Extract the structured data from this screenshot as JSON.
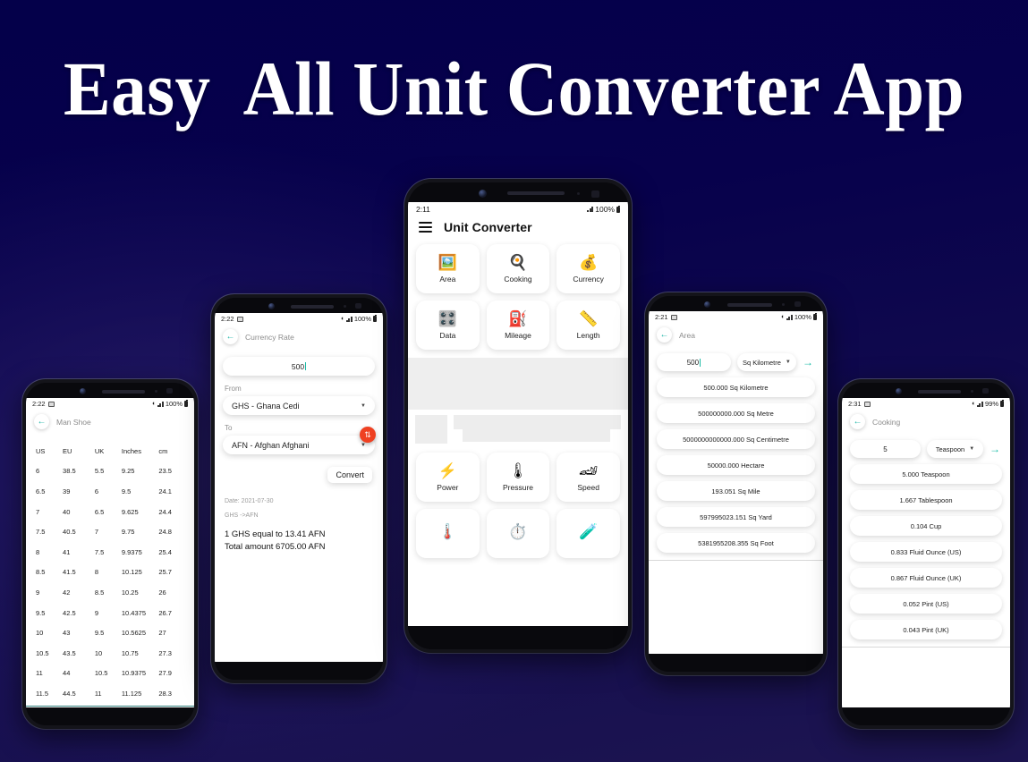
{
  "hero": {
    "title": "Easy  All Unit Converter App"
  },
  "colors": {
    "bg_top": "#04004a",
    "bg_bottom": "#1d1551",
    "accent_teal": "#16bba6",
    "swap_red": "#ef4122",
    "divider_teal": "#2e7e7a"
  },
  "phones": {
    "shoe": {
      "status": {
        "time": "2:22",
        "battery": "100%",
        "wifi": "wifi-icon",
        "signal": "signal-icon",
        "screenshot": "image-icon"
      },
      "title": "Man Shoe",
      "back": "back-arrow-icon",
      "table": {
        "headers": [
          "US",
          "EU",
          "UK",
          "Inches",
          "cm"
        ],
        "rows": [
          [
            "6",
            "38.5",
            "5.5",
            "9.25",
            "23.5"
          ],
          [
            "6.5",
            "39",
            "6",
            "9.5",
            "24.1"
          ],
          [
            "7",
            "40",
            "6.5",
            "9.625",
            "24.4"
          ],
          [
            "7.5",
            "40.5",
            "7",
            "9.75",
            "24.8"
          ],
          [
            "8",
            "41",
            "7.5",
            "9.9375",
            "25.4"
          ],
          [
            "8.5",
            "41.5",
            "8",
            "10.125",
            "25.7"
          ],
          [
            "9",
            "42",
            "8.5",
            "10.25",
            "26"
          ],
          [
            "9.5",
            "42.5",
            "9",
            "10.4375",
            "26.7"
          ],
          [
            "10",
            "43",
            "9.5",
            "10.5625",
            "27"
          ],
          [
            "10.5",
            "43.5",
            "10",
            "10.75",
            "27.3"
          ],
          [
            "11",
            "44",
            "10.5",
            "10.9375",
            "27.9"
          ],
          [
            "11.5",
            "44.5",
            "11",
            "11.125",
            "28.3"
          ]
        ]
      }
    },
    "currency": {
      "status": {
        "time": "2:22",
        "battery": "100%"
      },
      "title": "Currency Rate",
      "amount": "500",
      "from_label": "From",
      "from_value": "GHS - Ghana Cedi",
      "to_label": "To",
      "to_value": "AFN - Afghan Afghani",
      "swap_icon": "swap-vertical-icon",
      "convert_label": "Convert",
      "date": "Date: 2021-07-30",
      "pair": "GHS ->AFN",
      "rate_line": "1 GHS equal to 13.41 AFN",
      "total_line": "Total amount 6705.00 AFN"
    },
    "home": {
      "status": {
        "time": "2:11",
        "battery": "100%"
      },
      "title": "Unit Converter",
      "menu_icon": "hamburger-menu-icon",
      "tiles_row1": [
        {
          "label": "Area",
          "icon": "🖼️"
        },
        {
          "label": "Cooking",
          "icon": "🍳"
        },
        {
          "label": "Currency",
          "icon": "💰"
        }
      ],
      "tiles_row2": [
        {
          "label": "Data",
          "icon": "🎛️"
        },
        {
          "label": "Mileage",
          "icon": "⛽"
        },
        {
          "label": "Length",
          "icon": "📏"
        }
      ],
      "tiles_row3": [
        {
          "label": "Power",
          "icon": "⚡"
        },
        {
          "label": "Pressure",
          "icon": "🌡"
        },
        {
          "label": "Speed",
          "icon": "🏎"
        }
      ],
      "tiles_row4": [
        {
          "label": "",
          "icon": "🌡️"
        },
        {
          "label": "",
          "icon": "⏱️"
        },
        {
          "label": "",
          "icon": "🧪"
        }
      ]
    },
    "area": {
      "status": {
        "time": "2:21",
        "battery": "100%"
      },
      "title": "Area",
      "input_value": "500",
      "unit_value": "Sq Kilometre",
      "go_icon": "arrow-right-icon",
      "results": [
        "500.000 Sq Kilometre",
        "500000000.000 Sq Metre",
        "5000000000000.000 Sq Centimetre",
        "50000.000 Hectare",
        "193.051 Sq Mile",
        "597995023.151 Sq Yard",
        "5381955208.355 Sq Foot"
      ]
    },
    "cooking": {
      "status": {
        "time": "2:31",
        "battery": "99%"
      },
      "title": "Cooking",
      "input_value": "5",
      "unit_value": "Teaspoon",
      "go_icon": "arrow-right-icon",
      "results": [
        "5.000 Teaspoon",
        "1.667 Tablespoon",
        "0.104 Cup",
        "0.833 Fluid Ounce (US)",
        "0.867 Fluid Ounce (UK)",
        "0.052 Pint (US)",
        "0.043 Pint (UK)"
      ]
    }
  }
}
